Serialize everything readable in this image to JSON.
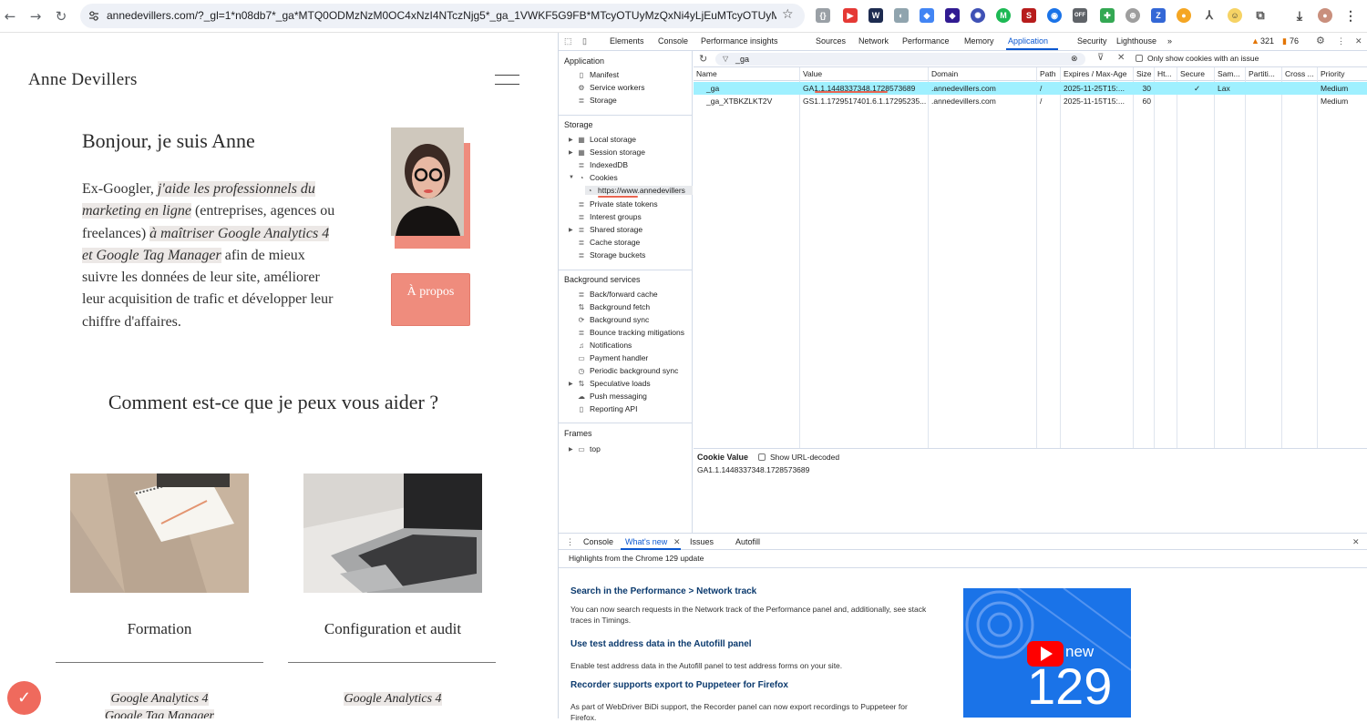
{
  "browser": {
    "url": "annedevillers.com/?_gl=1*n08db7*_ga*MTQ0ODMzNzM0OC4xNzI4NTczNjg5*_ga_1VWKF5G9FB*MTcyOTUyMzQxNi4yLjEuMTcyOTUyMz...",
    "ext_off_label": "OFF"
  },
  "site": {
    "logo": "Anne Devillers",
    "hero_title": "Bonjour, je suis Anne",
    "hero_p1": "Ex-Googler, ",
    "hero_em1": "j'aide les professionnels du marketing en ligne",
    "hero_p2": " (entreprises, agences ou freelances) ",
    "hero_em2": "à maîtriser Google Analytics 4 et Google Tag Manager",
    "hero_p3": " afin de mieux suivre les données de leur site, améliorer leur acquisition de trafic et développer leur chiffre d'affaires.",
    "about_button": "À propos",
    "help_title": "Comment est-ce que je peux vous aider ?",
    "services": [
      {
        "title": "Formation",
        "sub1": "Google Analytics 4",
        "sub2": "Google Tag Manager"
      },
      {
        "title": "Configuration et audit",
        "sub1": "Google Analytics 4"
      }
    ]
  },
  "devtools": {
    "tabs": [
      "Elements",
      "Console",
      "Performance insights",
      "Sources",
      "Network",
      "Performance",
      "Memory",
      "Application",
      "Security",
      "Lighthouse"
    ],
    "more_tabs": "»",
    "warnings": "321",
    "issues": "76",
    "sidebar": {
      "application_header": "Application",
      "application_items": [
        "Manifest",
        "Service workers",
        "Storage"
      ],
      "storage_header": "Storage",
      "storage_items": [
        "Local storage",
        "Session storage",
        "IndexedDB",
        "Cookies",
        "https://www.annedevillers",
        "Private state tokens",
        "Interest groups",
        "Shared storage",
        "Cache storage",
        "Storage buckets"
      ],
      "background_header": "Background services",
      "background_items": [
        "Back/forward cache",
        "Background fetch",
        "Background sync",
        "Bounce tracking mitigations",
        "Notifications",
        "Payment handler",
        "Periodic background sync",
        "Speculative loads",
        "Push messaging",
        "Reporting API"
      ],
      "frames_header": "Frames",
      "frames_items": [
        "top"
      ]
    },
    "filter": {
      "value": "_ga",
      "only_issue_label": "Only show cookies with an issue"
    },
    "table": {
      "columns": [
        "Name",
        "Value",
        "Domain",
        "Path",
        "Expires / Max-Age",
        "Size",
        "Ht...",
        "Secure",
        "Sam...",
        "Partiti...",
        "Cross ...",
        "Priority"
      ],
      "rows": [
        [
          "_ga",
          "GA1.1.1448337348.1728573689",
          ".annedevillers.com",
          "/",
          "2025-11-25T15:...",
          "30",
          "",
          "✓",
          "Lax",
          "",
          "",
          "Medium"
        ],
        [
          "_ga_XTBKZLKT2V",
          "GS1.1.1729517401.6.1.17295235...",
          ".annedevillers.com",
          "/",
          "2025-11-15T15:...",
          "60",
          "",
          "",
          "",
          "",
          "",
          "Medium"
        ]
      ]
    },
    "cookie_value": {
      "label": "Cookie Value",
      "decode_label": "Show URL-decoded",
      "value": "GA1.1.1448337348.1728573689"
    },
    "drawer": {
      "tabs": [
        "Console",
        "What's new",
        "Issues",
        "Autofill"
      ],
      "highlights": "Highlights from the Chrome 129 update",
      "items": [
        {
          "title": "Search in the Performance > Network track",
          "text": "You can now search requests in the Network track of the Performance panel and, additionally, see stack traces in Timings."
        },
        {
          "title": "Use test address data in the Autofill panel",
          "text": "Enable test address data in the Autofill panel to test address forms on your site."
        },
        {
          "title": "Recorder supports export to Puppeteer for Firefox",
          "text": "As part of WebDriver BiDi support, the Recorder panel can now export recordings to Puppeteer for Firefox."
        }
      ],
      "promo_new": "new",
      "promo_version": "129"
    }
  },
  "colors": {
    "accent": "#ef8c7d",
    "devtools_blue": "#0b57d0",
    "selected_row": "#9ff0ff"
  }
}
